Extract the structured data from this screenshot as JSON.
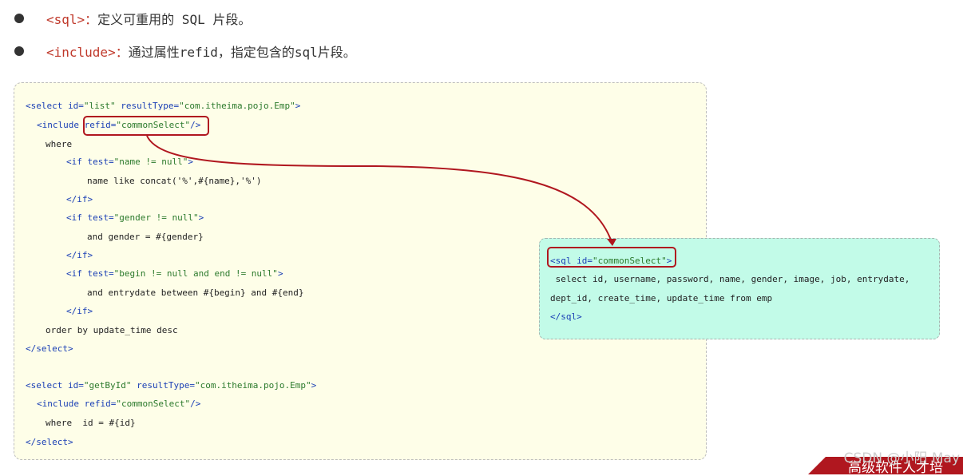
{
  "bullets": [
    {
      "tag": "<sql>：",
      "desc": "定义可重用的 SQL 片段。"
    },
    {
      "tag": "<include>：",
      "desc": "通过属性refid，指定包含的sql片段。"
    }
  ],
  "code": {
    "l1": {
      "open": "<select ",
      "a1n": "id=",
      "a1v": "\"list\"",
      "a2n": " resultType=",
      "a2v": "\"com.itheima.pojo.Emp\"",
      "close": ">"
    },
    "l2": {
      "open": "<include ",
      "an": "refid=",
      "av": "\"commonSelect\"",
      "close": "/>"
    },
    "l3": "where",
    "l4": {
      "open": "<if ",
      "an": "test=",
      "av": "\"name != null\"",
      "close": ">"
    },
    "l5": "name like concat('%',#{name},'%')",
    "l6": "</if>",
    "l7": {
      "open": "<if ",
      "an": "test=",
      "av": "\"gender != null\"",
      "close": ">"
    },
    "l8": "and gender = #{gender}",
    "l9": "</if>",
    "l10": {
      "open": "<if ",
      "an": "test=",
      "av": "\"begin != null and end != null\"",
      "close": ">"
    },
    "l11": "and entrydate between #{begin} and #{end}",
    "l12": "</if>",
    "l13": "order by update_time desc",
    "l14": "</select>",
    "l15": {
      "open": "<select ",
      "a1n": "id=",
      "a1v": "\"getById\"",
      "a2n": " resultType=",
      "a2v": "\"com.itheima.pojo.Emp\"",
      "close": ">"
    },
    "l16": {
      "open": "<include ",
      "an": "refid=",
      "av": "\"commonSelect\"",
      "close": "/>"
    },
    "l17": "where  id = #{id}",
    "l18": "</select>"
  },
  "sql": {
    "l1": {
      "open": "<sql ",
      "an": "id=",
      "av": "\"commonSelect\"",
      "close": ">"
    },
    "l2": " select id, username, password, name, gender, image, job, entrydate,",
    "l3": "dept_id, create_time, update_time from emp",
    "l4": "</sql>"
  },
  "watermark": "CSDN @小阳 May",
  "banner": "高级软件人才培",
  "colors": {
    "highlight": "#b0171f",
    "code_bg": "#fefee8",
    "sql_bg": "#c2fbe8"
  }
}
